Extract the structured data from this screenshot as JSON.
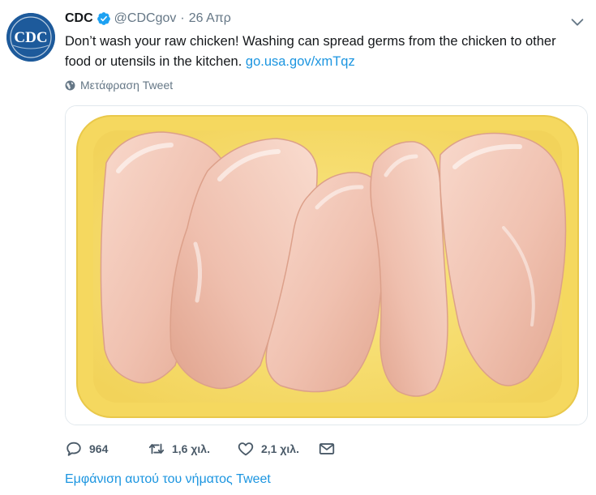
{
  "tweet": {
    "author_name": "CDC",
    "handle": "@CDCgov",
    "separator": "·",
    "date": "26 Απρ",
    "text": "Don’t wash your raw chicken! Washing can spread germs from the chicken to other food or utensils in the kitchen.",
    "link": "go.usa.gov/xmTqz",
    "translate_label": "Μετάφραση Tweet",
    "avatar_text": "CDC",
    "image_alt": "Raw chicken breasts in a yellow foam tray"
  },
  "actions": {
    "replies": "964",
    "retweets": "1,6 χιλ.",
    "likes": "2,1 χιλ."
  },
  "thread_link": "Εμφάνιση αυτού του νήματος Tweet",
  "colors": {
    "link": "#1b95e0",
    "secondary": "#657786",
    "verified": "#1da1f2",
    "cdc_blue": "#1d5a9b",
    "tray": "#f6dd6a",
    "chicken": "#f2c4b4"
  },
  "icons": [
    "verified-badge-icon",
    "chevron-down-icon",
    "globe-icon",
    "reply-icon",
    "retweet-icon",
    "like-icon",
    "dm-icon"
  ]
}
